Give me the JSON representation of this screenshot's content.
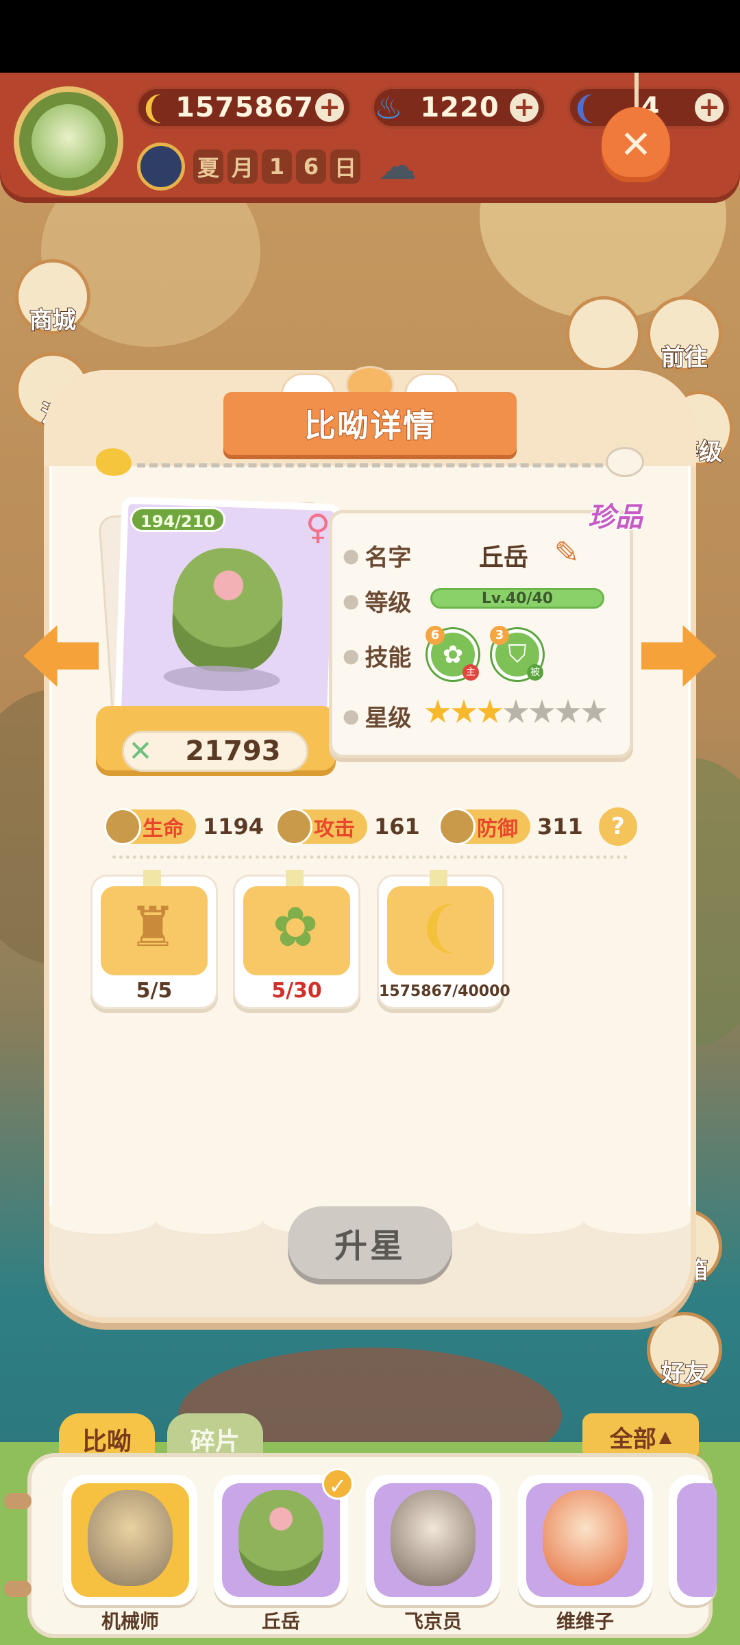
{
  "hud": {
    "bananas": "1575867",
    "flames": "1220",
    "blue_banana": "4",
    "date_chars": [
      "夏",
      "月",
      "1",
      "6",
      "日"
    ],
    "weather_icon": "rain-cloud-icon",
    "close_icon": "close-icon"
  },
  "side_buttons": {
    "shop": "商城",
    "activity": "活",
    "goto": "前往",
    "level": "等级",
    "mailbox": "邮箱",
    "friends": "好友"
  },
  "panel": {
    "title": "比呦详情",
    "rarity": "珍品",
    "shards": "194/210",
    "power": "21793",
    "info": {
      "name_label": "名字",
      "name_value": "丘岳",
      "level_label": "等级",
      "level_value": "Lv.40/40",
      "skill_label": "技能",
      "skills": [
        {
          "level": "6",
          "tag": "主"
        },
        {
          "level": "3",
          "tag": "被"
        }
      ],
      "star_label": "星级",
      "stars_filled": 3,
      "stars_total": 7
    },
    "stats": [
      {
        "label": "生命",
        "value": "1194"
      },
      {
        "label": "攻击",
        "value": "161"
      },
      {
        "label": "防御",
        "value": "311"
      }
    ],
    "help": "?",
    "materials": [
      {
        "count": "5/5"
      },
      {
        "count": "5/30"
      },
      {
        "count": "1575867/40000"
      }
    ],
    "upgrade_button": "升星"
  },
  "roster": {
    "tabs": [
      "比呦",
      "碎片"
    ],
    "filter": "全部",
    "pets": [
      {
        "name": "机械师"
      },
      {
        "name": "丘岳"
      },
      {
        "name": "飞京员"
      },
      {
        "name": "维维子"
      }
    ]
  },
  "colors": {
    "hud_red": "#b5462d",
    "panel_cream": "#fcf6ea",
    "accent_orange": "#f0904a",
    "stat_red": "#e8472c"
  }
}
